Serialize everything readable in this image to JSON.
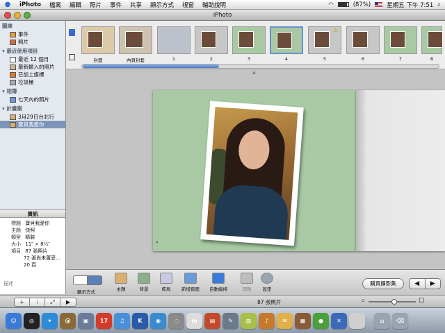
{
  "menubar": {
    "app_name": "iPhoto",
    "menus": [
      "檔案",
      "編輯",
      "照片",
      "事件",
      "共享",
      "顯示方式",
      "視窗",
      "輔助說明"
    ],
    "battery_text": "(87%)",
    "battery_level": 0.87,
    "clock": "星期五 下午 7:51"
  },
  "window": {
    "title": "iPhoto"
  },
  "sidebar": {
    "library": {
      "heading": "圖庫",
      "items": [
        "事件",
        "照片"
      ]
    },
    "recent": {
      "heading": "最近使用項目",
      "items": [
        "最近 12 個月",
        "最新輸入的照片",
        "已加上旗標",
        "垃圾桶"
      ]
    },
    "albums": {
      "heading": "相簿",
      "items": [
        "七天內的照片"
      ]
    },
    "projects": {
      "heading": "計畫案",
      "items": [
        "3月29日台北行",
        "寶貝我愛你"
      ]
    }
  },
  "info": {
    "header": "資訊",
    "rows": [
      {
        "key": "標題",
        "value": "寶貝我愛你"
      },
      {
        "key": "主題",
        "value": "快照"
      },
      {
        "key": "類型",
        "value": "精裝"
      },
      {
        "key": "大小",
        "value": "11″ × 8½″"
      },
      {
        "key": "項目",
        "value": "87 張照片"
      }
    ],
    "unplaced": "72 張尚未置妥...",
    "pages": "20 頁",
    "description_label": "描述"
  },
  "strip": {
    "thumb_labels": [
      "封面",
      "內頁封套",
      "1",
      "2",
      "3",
      "4",
      "5",
      "6",
      "7",
      "8"
    ],
    "selected_index": 5
  },
  "toolbar": {
    "view_label": "顯示方式",
    "theme": "主題",
    "background": "背景",
    "layout": "佈局",
    "add_page": "新增頁面",
    "autoflow": "自動編排",
    "adjust": "調整",
    "settings": "設定",
    "buy": "購買攝影集",
    "prev_glyph": "◀",
    "next_glyph": "▶"
  },
  "status": {
    "photo_count": "87 張照片",
    "zoom_level": 0.55,
    "buttons": [
      "+",
      "i",
      "⤢",
      "▶"
    ]
  },
  "canvas": {
    "page_number": "4"
  },
  "dock": {
    "apps": [
      {
        "name": "finder",
        "color": "#3b7bd8",
        "glyph": "☺"
      },
      {
        "name": "dashboard",
        "color": "#222222",
        "glyph": "◎"
      },
      {
        "name": "safari",
        "color": "#2f8ad8",
        "glyph": "✦"
      },
      {
        "name": "address-book",
        "color": "#8a6a3a",
        "glyph": "@"
      },
      {
        "name": "iphoto",
        "color": "#6a7c9a",
        "glyph": "▣"
      },
      {
        "name": "ical",
        "color": "#d23a2a",
        "glyph": "17"
      },
      {
        "name": "itunes",
        "color": "#4a8fd8",
        "glyph": "♫"
      },
      {
        "name": "k-app",
        "color": "#2a5aa8",
        "glyph": "K"
      },
      {
        "name": "utility",
        "color": "#3a8ad0",
        "glyph": "◉"
      },
      {
        "name": "dvd",
        "color": "#8a8a8a",
        "glyph": "◌"
      },
      {
        "name": "msn",
        "color": "#dcdcdc",
        "glyph": "m"
      },
      {
        "name": "film",
        "color": "#c24a2a",
        "glyph": "▤"
      },
      {
        "name": "pen",
        "color": "#6a7a8a",
        "glyph": "✎"
      },
      {
        "name": "chart",
        "color": "#a8c04a",
        "glyph": "▥"
      },
      {
        "name": "guitar",
        "color": "#c8782a",
        "glyph": "♪"
      },
      {
        "name": "keys",
        "color": "#e0b04a",
        "glyph": "✉"
      },
      {
        "name": "photos",
        "color": "#8a5a3a",
        "glyph": "▦"
      },
      {
        "name": "green",
        "color": "#4aa03a",
        "glyph": "●"
      },
      {
        "name": "xcode",
        "color": "#3a6ab8",
        "glyph": "✕"
      },
      {
        "name": "apple",
        "color": "#cfcfcf",
        "glyph": ""
      },
      {
        "name": "downloads",
        "color": "#9aa4b0",
        "glyph": "⌂"
      },
      {
        "name": "trash",
        "color": "#9aa4b0",
        "glyph": "⌫"
      }
    ]
  }
}
